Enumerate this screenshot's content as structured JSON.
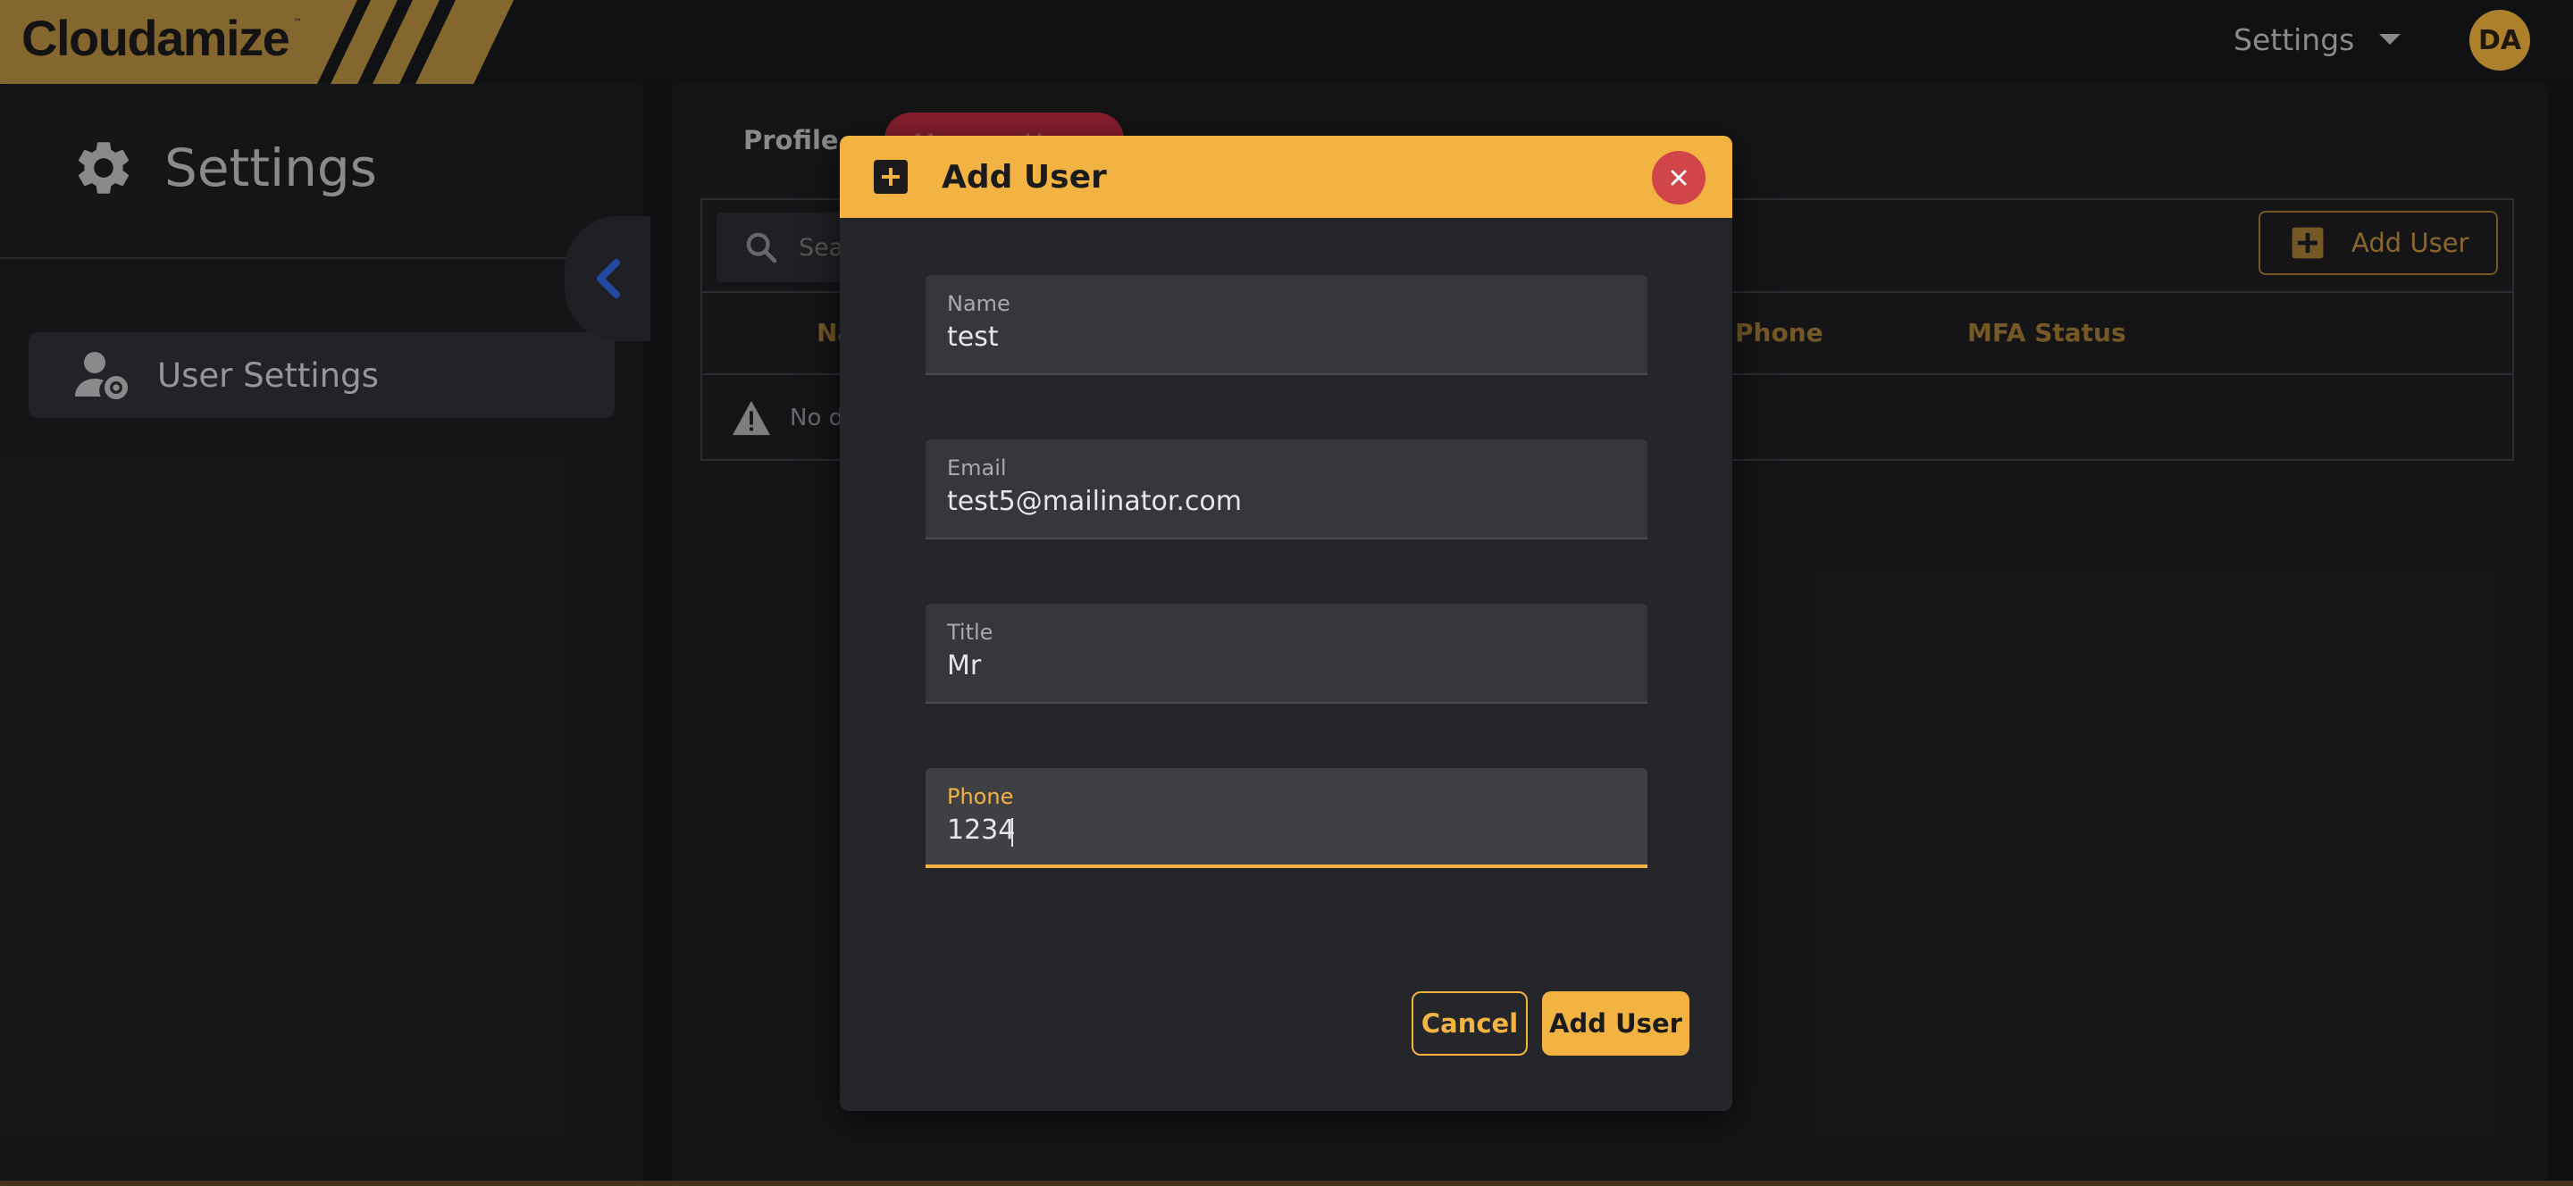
{
  "app": {
    "logo_text": "Cloudamize",
    "logo_tm": "™",
    "brand_color": "#f2b343"
  },
  "topbar": {
    "settings_label": "Settings",
    "avatar_initials": "DA"
  },
  "sidebar": {
    "title": "Settings",
    "items": [
      {
        "label": "User Settings",
        "icon": "user-gear-icon"
      }
    ]
  },
  "main": {
    "tabs": [
      {
        "label": "Profile"
      },
      {
        "label": "Manage Users"
      }
    ],
    "search": {
      "placeholder": "Search"
    },
    "add_user_label": "Add User",
    "columns": [
      "Name",
      "Phone",
      "MFA Status"
    ],
    "empty_text": "No data"
  },
  "modal": {
    "title": "Add User",
    "fields": [
      {
        "label": "Name",
        "value": "test"
      },
      {
        "label": "Email",
        "value": "test5@mailinator.com"
      },
      {
        "label": "Title",
        "value": "Mr"
      },
      {
        "label": "Phone",
        "value": "1234"
      }
    ],
    "cancel_label": "Cancel",
    "submit_label": "Add User"
  }
}
